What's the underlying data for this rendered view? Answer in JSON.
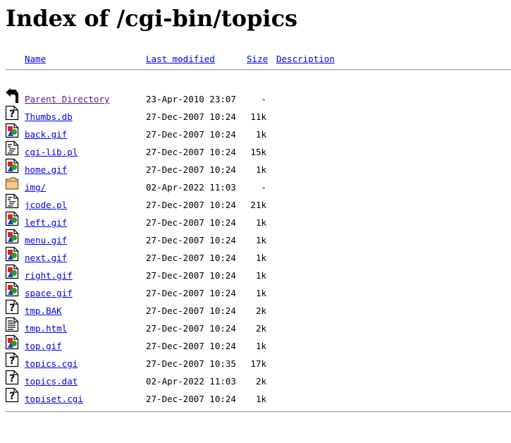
{
  "page": {
    "title": "Index of /cgi-bin/topics"
  },
  "columns": {
    "name": "Name",
    "last_modified": "Last modified",
    "size": "Size",
    "description": "Description"
  },
  "entries": [
    {
      "icon": "back-icon",
      "name": "Parent Directory",
      "modified": "23-Apr-2010 23:07",
      "size": "-",
      "visited": true
    },
    {
      "icon": "unknown-file-icon",
      "name": "Thumbs.db",
      "modified": "27-Dec-2007 10:24",
      "size": "11k",
      "visited": false
    },
    {
      "icon": "image-file-icon",
      "name": "back.gif",
      "modified": "27-Dec-2007 10:24",
      "size": "1k",
      "visited": false
    },
    {
      "icon": "script-file-icon",
      "name": "cgi-lib.pl",
      "modified": "27-Dec-2007 10:24",
      "size": "15k",
      "visited": false
    },
    {
      "icon": "image-file-icon",
      "name": "home.gif",
      "modified": "27-Dec-2007 10:24",
      "size": "1k",
      "visited": false
    },
    {
      "icon": "folder-icon",
      "name": "img/",
      "modified": "02-Apr-2022 11:03",
      "size": "-",
      "visited": false
    },
    {
      "icon": "script-file-icon",
      "name": "jcode.pl",
      "modified": "27-Dec-2007 10:24",
      "size": "21k",
      "visited": false
    },
    {
      "icon": "image-file-icon",
      "name": "left.gif",
      "modified": "27-Dec-2007 10:24",
      "size": "1k",
      "visited": false
    },
    {
      "icon": "image-file-icon",
      "name": "menu.gif",
      "modified": "27-Dec-2007 10:24",
      "size": "1k",
      "visited": false
    },
    {
      "icon": "image-file-icon",
      "name": "next.gif",
      "modified": "27-Dec-2007 10:24",
      "size": "1k",
      "visited": false
    },
    {
      "icon": "image-file-icon",
      "name": "right.gif",
      "modified": "27-Dec-2007 10:24",
      "size": "1k",
      "visited": false
    },
    {
      "icon": "image-file-icon",
      "name": "space.gif",
      "modified": "27-Dec-2007 10:24",
      "size": "1k",
      "visited": false
    },
    {
      "icon": "unknown-file-icon",
      "name": "tmp.BAK",
      "modified": "27-Dec-2007 10:24",
      "size": "2k",
      "visited": false
    },
    {
      "icon": "text-file-icon",
      "name": "tmp.html",
      "modified": "27-Dec-2007 10:24",
      "size": "2k",
      "visited": false
    },
    {
      "icon": "image-file-icon",
      "name": "top.gif",
      "modified": "27-Dec-2007 10:24",
      "size": "1k",
      "visited": false
    },
    {
      "icon": "unknown-file-icon",
      "name": "topics.cgi",
      "modified": "27-Dec-2007 10:35",
      "size": "17k",
      "visited": false
    },
    {
      "icon": "unknown-file-icon",
      "name": "topics.dat",
      "modified": "02-Apr-2022 11:03",
      "size": "2k",
      "visited": false
    },
    {
      "icon": "unknown-file-icon",
      "name": "topiset.cgi",
      "modified": "27-Dec-2007 10:24",
      "size": "1k",
      "visited": false
    }
  ],
  "colors": {
    "link": "#0000ee",
    "visited_link": "#551a8b",
    "rule": "#9e9e9e"
  }
}
